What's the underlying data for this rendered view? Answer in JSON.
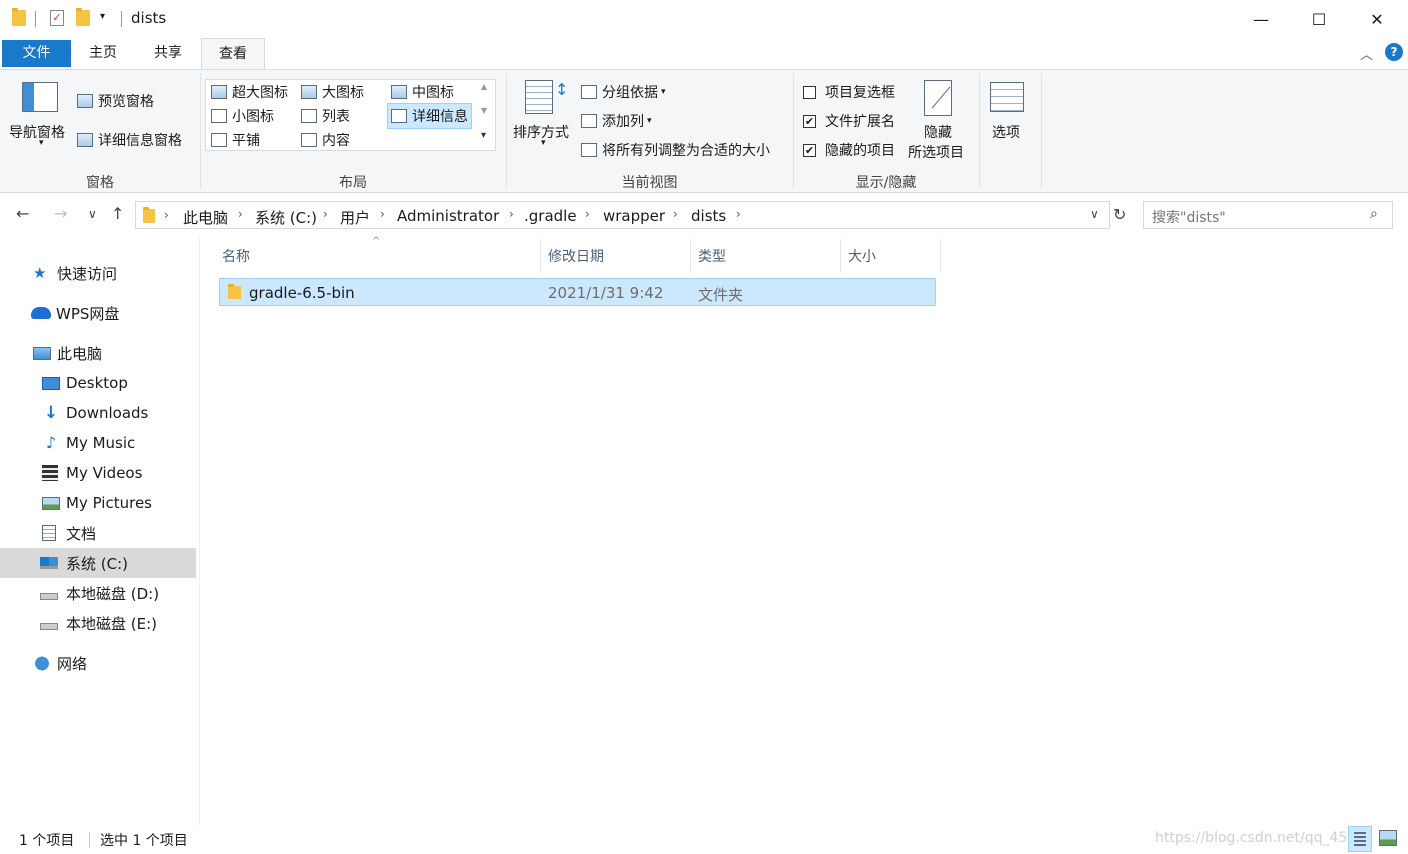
{
  "window": {
    "title": "dists",
    "minimize": "—",
    "maximize": "☐",
    "close": "✕"
  },
  "ribbon_tabs": [
    {
      "label": "文件"
    },
    {
      "label": "主页"
    },
    {
      "label": "共享"
    },
    {
      "label": "查看"
    }
  ],
  "ribbon": {
    "panes": {
      "nav_pane": "导航窗格",
      "preview_pane": "预览窗格",
      "details_pane": "详细信息窗格",
      "group_label": "窗格"
    },
    "layout": {
      "extra_large": "超大图标",
      "large": "大图标",
      "medium": "中图标",
      "small": "小图标",
      "list": "列表",
      "details": "详细信息",
      "tiles": "平铺",
      "content": "内容",
      "group_label": "布局"
    },
    "current_view": {
      "sort_by": "排序方式",
      "group_by": "分组依据",
      "add_columns": "添加列",
      "size_columns": "将所有列调整为合适的大小",
      "group_label": "当前视图"
    },
    "show_hide": {
      "item_checkboxes": "项目复选框",
      "item_checkboxes_checked": false,
      "file_extensions": "文件扩展名",
      "file_extensions_checked": true,
      "hidden_items": "隐藏的项目",
      "hidden_items_checked": true,
      "hide_selected_line1": "隐藏",
      "hide_selected_line2": "所选项目",
      "group_label": "显示/隐藏"
    },
    "options": "选项"
  },
  "address": {
    "crumbs": [
      "此电脑",
      "系统 (C:)",
      "用户",
      "Administrator",
      ".gradle",
      "wrapper",
      "dists"
    ],
    "search_placeholder": "搜索\"dists\""
  },
  "nav": {
    "quick_access": "快速访问",
    "wps": "WPS网盘",
    "this_pc": "此电脑",
    "desktop": "Desktop",
    "downloads": "Downloads",
    "music": "My Music",
    "videos": "My Videos",
    "pictures": "My Pictures",
    "documents": "文档",
    "drive_c": "系统 (C:)",
    "drive_d": "本地磁盘 (D:)",
    "drive_e": "本地磁盘 (E:)",
    "network": "网络"
  },
  "columns": {
    "name": "名称",
    "modified": "修改日期",
    "type": "类型",
    "size": "大小"
  },
  "files": [
    {
      "name": "gradle-6.5-bin",
      "modified": "2021/1/31 9:42",
      "type": "文件夹",
      "size": ""
    }
  ],
  "status": {
    "count": "1 个项目",
    "selected": "选中 1 个项目"
  },
  "watermark": "https://blog.csdn.net/qq_45"
}
